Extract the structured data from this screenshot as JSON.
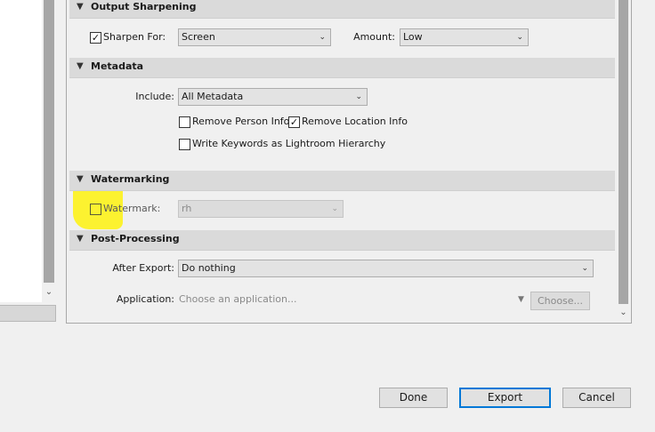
{
  "sections": {
    "output_sharpening": {
      "title": "Output Sharpening",
      "sharpen_for_label": "Sharpen For:",
      "sharpen_for_checked": true,
      "sharpen_for_value": "Screen",
      "amount_label": "Amount:",
      "amount_value": "Low"
    },
    "metadata": {
      "title": "Metadata",
      "include_label": "Include:",
      "include_value": "All Metadata",
      "remove_person_info_label": "Remove Person Info",
      "remove_person_info_checked": false,
      "remove_location_info_label": "Remove Location Info",
      "remove_location_info_checked": true,
      "write_keywords_label": "Write Keywords as Lightroom Hierarchy",
      "write_keywords_checked": false
    },
    "watermarking": {
      "title": "Watermarking",
      "watermark_label": "Watermark:",
      "watermark_checked": false,
      "watermark_value": "rh"
    },
    "post_processing": {
      "title": "Post-Processing",
      "after_export_label": "After Export:",
      "after_export_value": "Do nothing",
      "application_label": "Application:",
      "application_placeholder": "Choose an application...",
      "choose_button": "Choose..."
    }
  },
  "footer": {
    "done_label": "Done",
    "export_label": "Export",
    "cancel_label": "Cancel"
  },
  "icons": {
    "collapse": "triangle-down-icon",
    "dropdown": "chevron-down-icon",
    "check": "checkmark-icon"
  },
  "colors": {
    "highlight": "#fff200",
    "primary_button_border": "#0078d7",
    "section_header": "#dadada"
  }
}
